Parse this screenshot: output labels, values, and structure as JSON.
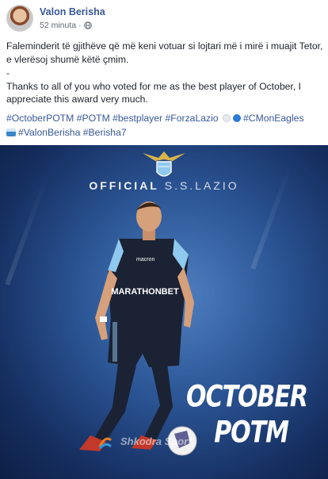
{
  "post": {
    "author": "Valon Berisha",
    "time": "52 minuta",
    "separator": "·",
    "text_sq": "Faleminderit të gjithëve që më keni votuar si lojtari më i mirë i muajit Tetor, e vlerësoj shumë këtë çmim.",
    "divider": "-",
    "text_en": "Thanks to all of you who voted for me as the best player of October, I appreciate this award very much.",
    "hashtags_line1": [
      "#OctoberPOTM",
      "#POTM",
      "#bestplayer",
      "#ForzaLazio"
    ],
    "hashtag_after_emoji": "#CMonEagles",
    "hashtags_line2": [
      "#ValonBerisha",
      "#Berisha7"
    ]
  },
  "image": {
    "club_prefix": "OFFICIAL",
    "club_name": "S.S.LAZIO",
    "award_line1": "OCTOBER",
    "award_line2": "POTM",
    "sponsor": "macron",
    "shirt_text": "MARATHONBET",
    "watermark": "Shkodra Sport"
  },
  "colors": {
    "link": "#385898",
    "sky_top": "#4f7fc0",
    "sky_bottom": "#0d1f45",
    "kit": "#1b2233",
    "kit_accent": "#8fc9ef"
  },
  "icons": [
    "globe-icon",
    "lazio-eagle-logo",
    "emoji-white-circle",
    "emoji-blue-circle",
    "emoji-water-wave"
  ]
}
